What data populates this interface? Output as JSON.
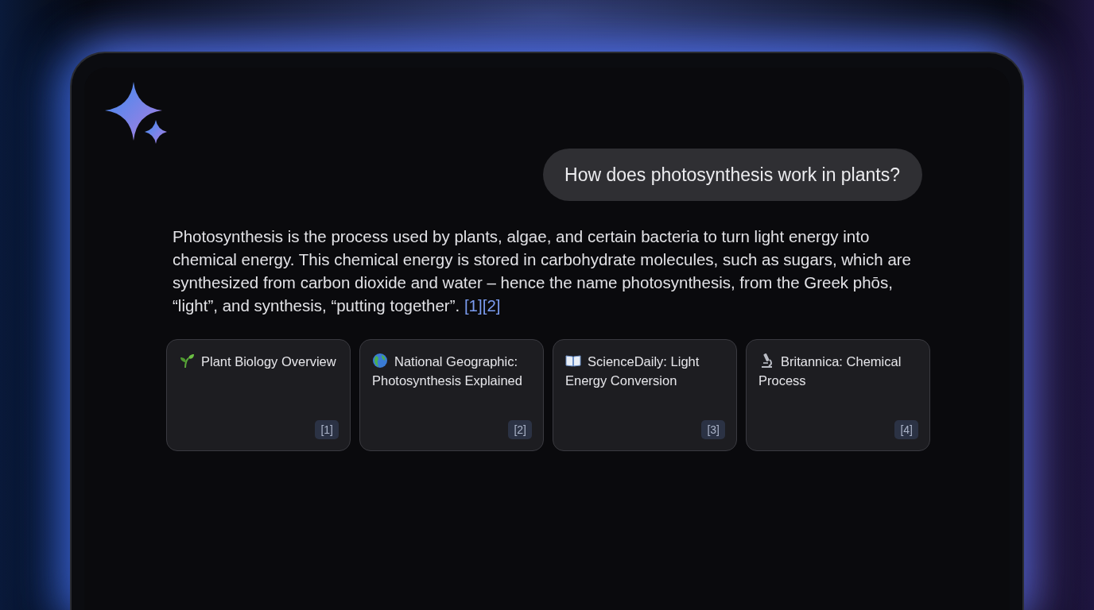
{
  "chat": {
    "question": "How does photosynthesis work in plants?",
    "answer": {
      "text": "Photosynthesis is the process used by plants, algae, and certain bacteria to turn light energy into chemical energy. This chemical energy is stored in carbohydrate molecules, such as sugars, which are synthesized from carbon dioxide and water – hence the name photosynthesis, from the Greek phōs, “light”, and synthesis, “putting together”.",
      "citations": [
        "[1]",
        "[2]"
      ]
    },
    "sources": [
      {
        "title": "Plant Biology Overview",
        "ref": "[1]"
      },
      {
        "title": "National Geographic: Photosynthesis Explained",
        "ref": "[2]"
      },
      {
        "title": "ScienceDaily: Light Energy Conversion",
        "ref": "[3]"
      },
      {
        "title": "Britannica: Chemical Process",
        "ref": "[4]"
      }
    ]
  }
}
